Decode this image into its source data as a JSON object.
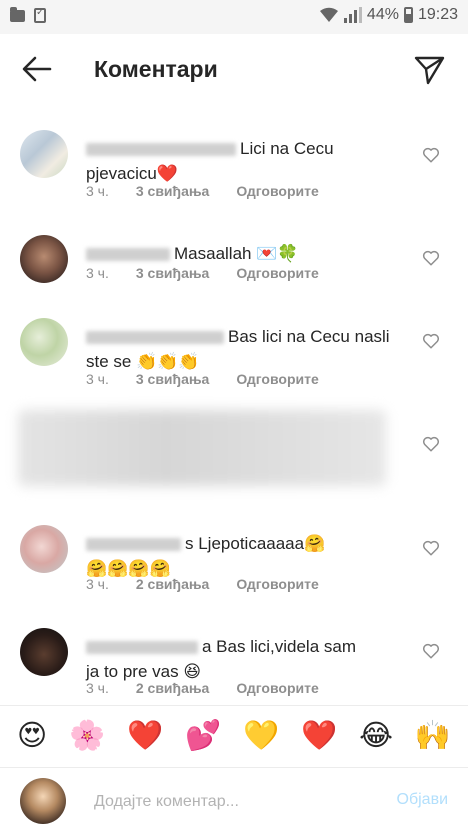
{
  "status_bar": {
    "battery": "44%",
    "time": "19:23"
  },
  "header": {
    "title": "Коментари"
  },
  "comments": [
    {
      "text_line1": "Lici na Cecu",
      "text_line2": "pjevacicu❤️",
      "time": "3 ч.",
      "likes": "3 свиђања",
      "reply": "Одговорите"
    },
    {
      "text": "Masaallah 💌🍀",
      "time": "3 ч.",
      "likes": "3 свиђања",
      "reply": "Одговорите"
    },
    {
      "text_line1": "Bas lici na Cecu nasli",
      "text_line2": "ste se 👏👏👏",
      "time": "3 ч.",
      "likes": "3 свиђања",
      "reply": "Одговорите"
    },
    {
      "text_line1": "s Ljepoticaaaaa🤗",
      "text_line2": "🤗🤗🤗🤗",
      "time": "3 ч.",
      "likes": "2 свиђања",
      "reply": "Одговорите"
    },
    {
      "text_line1": "a Bas lici,videla sam",
      "text_line2": "ja to pre vas 😆",
      "time": "3 ч.",
      "likes": "2 свиђања",
      "reply": "Одговорите"
    }
  ],
  "emoji_bar": [
    "😍",
    "🌸",
    "❤️",
    "💕",
    "💛",
    "❤️",
    "😂",
    "🙌"
  ],
  "input": {
    "placeholder": "Додајте коментар...",
    "post_label": "Објави"
  }
}
